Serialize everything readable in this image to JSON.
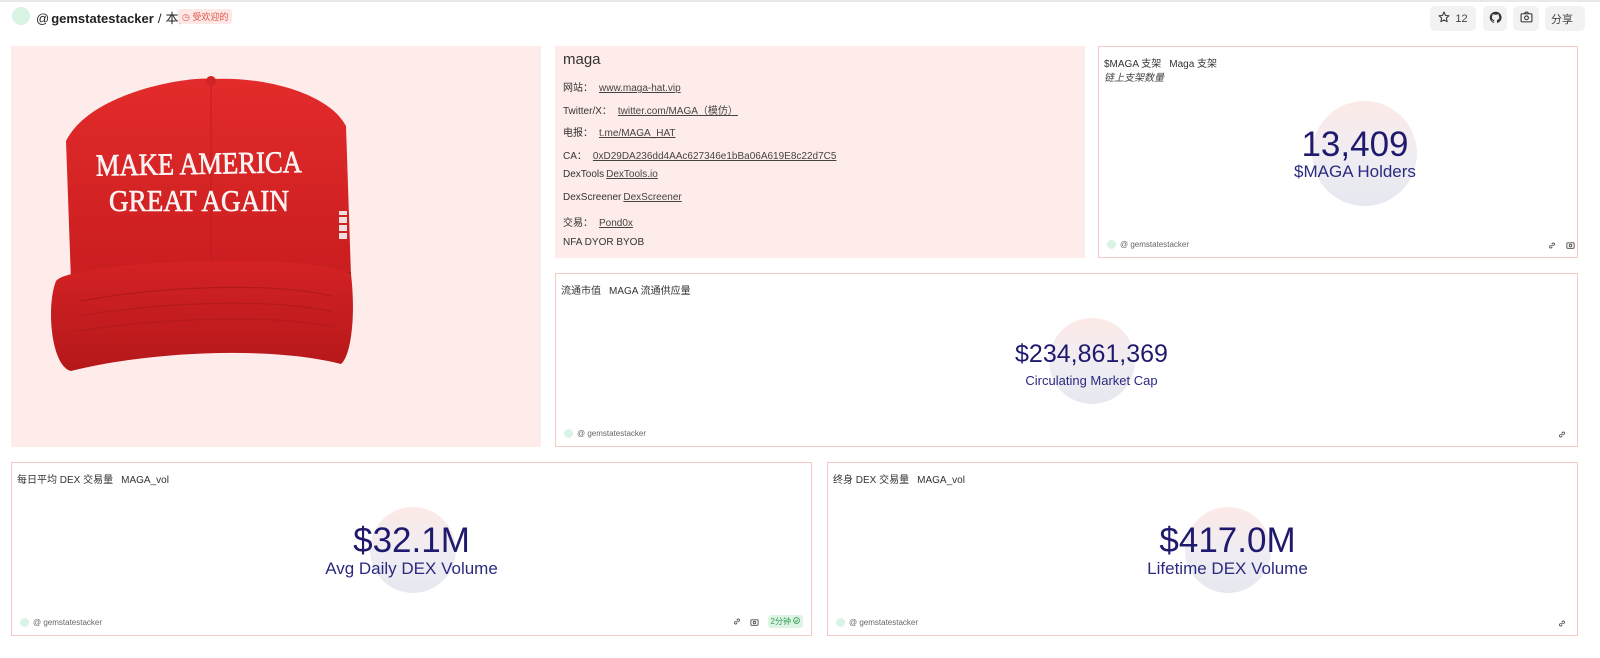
{
  "header": {
    "at": "@",
    "user": "gemstatestacker",
    "separator": "/",
    "page": "本身",
    "badge": "受欢迎的",
    "star_count": "12",
    "share_label": "分享"
  },
  "info": {
    "title": "maga",
    "rows": [
      {
        "label": "网站：",
        "link": "www.maga-hat.vip"
      },
      {
        "label": "Twitter/X：",
        "link": "twitter.com/MAGA（模仿）"
      },
      {
        "label": "电报：",
        "link": "t.me/MAGA_HAT"
      },
      {
        "label": "CA：",
        "link": "0xD29DA236dd4AAc627346e1bBa06A619E8c22d7C5"
      },
      {
        "label": "DexTools",
        "link": "DexTools.io"
      },
      {
        "label": "DexScreener",
        "link": "DexScreener"
      },
      {
        "label": "交易：",
        "link": "Pond0x"
      },
      {
        "label": "NFA DYOR BYOB",
        "link": ""
      }
    ]
  },
  "hat_image": {
    "line1": "MAKE AMERICA",
    "line2": "GREAT AGAIN"
  },
  "panels": {
    "holders": {
      "title": "$MAGA 支架",
      "sub": "Maga 支架",
      "subtitle": "链上支架数量",
      "value": "13,409",
      "label": "$MAGA Holders",
      "author": "@ gemstatestacker"
    },
    "mcap": {
      "title": "流通市值",
      "sub": "MAGA 流通供应量",
      "value": "$234,861,369",
      "label": "Circulating Market Cap",
      "author": "@ gemstatestacker"
    },
    "avgvol": {
      "title": "每日平均 DEX 交易量",
      "sub": "MAGA_vol",
      "value": "$32.1M",
      "label": "Avg Daily DEX Volume",
      "author": "@ gemstatestacker",
      "fresh": "2分钟"
    },
    "lifevol": {
      "title": "终身 DEX 交易量",
      "sub": "MAGA_vol",
      "value": "$417.0M",
      "label": "Lifetime DEX Volume",
      "author": "@ gemstatestacker"
    }
  },
  "colors": {
    "panel_bg": "#fdecea",
    "panel_border": "#f6c9c2",
    "number": "#1f1a6e",
    "badge_red": "#e0524a",
    "fresh_green": "#2e9b55"
  },
  "icons": {
    "star": "star-icon",
    "github": "github-icon",
    "camera": "camera-icon",
    "link": "link-icon",
    "clock": "clock-icon",
    "check": "check-circle-icon"
  }
}
